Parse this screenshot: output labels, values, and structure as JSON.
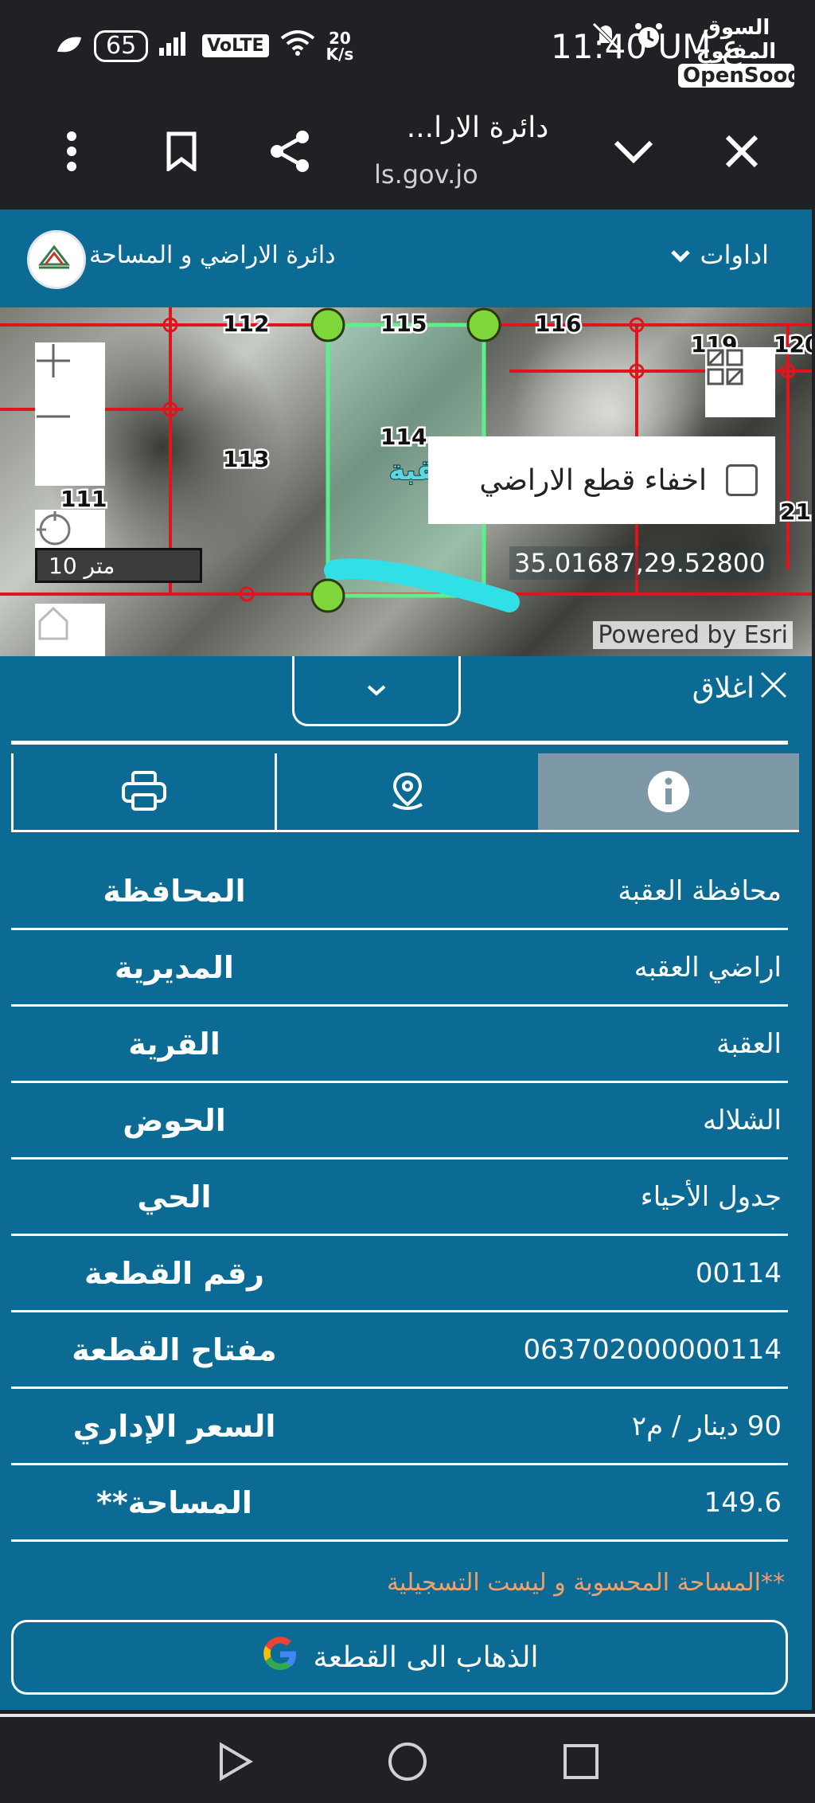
{
  "status_bar": {
    "battery": "65",
    "network_badge": "VoLTE",
    "speed_value": "20",
    "speed_unit": "K/s",
    "time": "11:40 UM ع",
    "watermark_ar": "السوق المفتوح",
    "watermark_en": "OpenSooq"
  },
  "browser": {
    "title": "دائرة الارا...",
    "url": "ls.gov.jo"
  },
  "header": {
    "app_title": "دائرة الاراضي و المساحة",
    "tools_label": "اداوات"
  },
  "map": {
    "parcel_labels": [
      "112",
      "115",
      "116",
      "119",
      "120",
      "113",
      "114",
      "111",
      "21"
    ],
    "area_label": "العقبة",
    "scale": "10 متر",
    "hide_parcels_label": "اخفاء قطع الاراضي",
    "coordinates": "35.01687,29.52800",
    "attribution": "Powered by Esri"
  },
  "panel": {
    "close_label": "اغلاق",
    "tabs": [
      {
        "name": "info",
        "icon": "info-icon"
      },
      {
        "name": "location",
        "icon": "map-pin-icon"
      },
      {
        "name": "print",
        "icon": "printer-icon"
      }
    ],
    "rows": [
      {
        "label": "المحافظة",
        "value": "محافظة العقبة"
      },
      {
        "label": "المديرية",
        "value": "اراضي العقبه"
      },
      {
        "label": "القرية",
        "value": "العقبة"
      },
      {
        "label": "الحوض",
        "value": "الشلاله"
      },
      {
        "label": "الحي",
        "value": "جدول الأحياء"
      },
      {
        "label": "رقم القطعة",
        "value": "00114"
      },
      {
        "label": "مفتاح القطعة",
        "value": "063702000000114"
      },
      {
        "label": "السعر الإداري",
        "value": "90 دينار / م٢"
      },
      {
        "label": "المساحة**",
        "value": "149.6"
      }
    ],
    "note": "**المساحة المحسوبة و ليست التسجيلية",
    "goto_button": "الذهاب الى القطعة"
  }
}
